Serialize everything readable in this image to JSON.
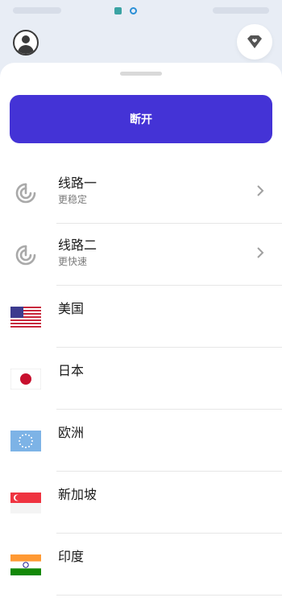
{
  "header": {
    "avatar_icon": "user-avatar-icon",
    "vip_icon": "diamond-heart-icon"
  },
  "main": {
    "disconnect_label": "断开",
    "accent_color": "#4433d6"
  },
  "servers": [
    {
      "title": "线路一",
      "subtitle": "更稳定",
      "icon": "signal-icon"
    },
    {
      "title": "线路二",
      "subtitle": "更快速",
      "icon": "signal-icon"
    },
    {
      "title": "美国",
      "icon": "us-flag-icon"
    },
    {
      "title": "日本",
      "icon": "jp-flag-icon"
    },
    {
      "title": "欧洲",
      "icon": "eu-flag-icon"
    },
    {
      "title": "新加坡",
      "icon": "sg-flag-icon"
    },
    {
      "title": "印度",
      "icon": "in-flag-icon"
    }
  ]
}
